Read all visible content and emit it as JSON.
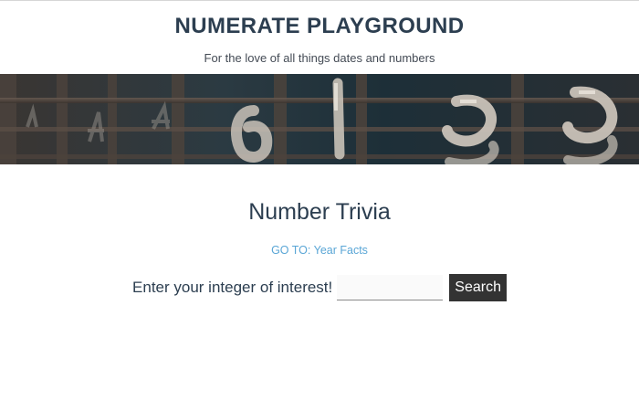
{
  "header": {
    "title": "NUMERATE PLAYGROUND",
    "tagline": "For the love of all things dates and numbers"
  },
  "banner": {
    "description_icon": "number-tiles-banner-image"
  },
  "main": {
    "section_title": "Number Trivia",
    "goto_link": "GO TO: Year Facts",
    "search": {
      "label": "Enter your integer of interest!",
      "input_value": "",
      "input_placeholder": "",
      "button_label": "Search"
    }
  },
  "colors": {
    "heading": "#2c3e50",
    "link": "#5aa6d6",
    "button_bg": "#333333",
    "button_text": "#ffffff"
  }
}
